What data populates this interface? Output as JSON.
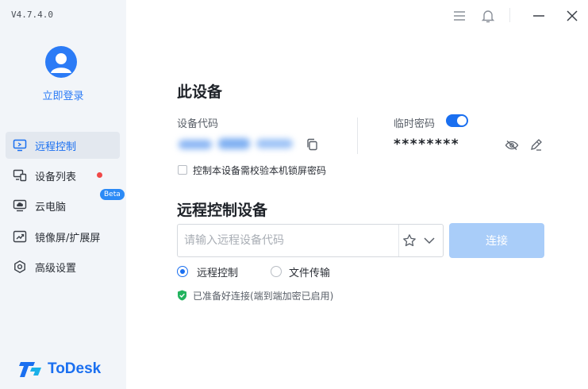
{
  "app": {
    "version": "V4.7.4.0",
    "brand": "ToDesk",
    "accent_color": "#1a6ff0"
  },
  "sidebar": {
    "login_label": "立即登录",
    "items": [
      {
        "label": "远程控制",
        "icon": "monitor-remote-icon",
        "active": true
      },
      {
        "label": "设备列表",
        "icon": "device-list-icon",
        "badge": "red-dot"
      },
      {
        "label": "云电脑",
        "icon": "cloud-pc-icon",
        "tag": "Beta"
      },
      {
        "label": "镜像屏/扩展屏",
        "icon": "mirror-screen-icon"
      },
      {
        "label": "高级设置",
        "icon": "gear-icon"
      }
    ]
  },
  "titlebar": {
    "icons": [
      "menu-icon",
      "bell-icon",
      "minimize-icon",
      "close-icon"
    ]
  },
  "this_device": {
    "title": "此设备",
    "code_label": "设备代码",
    "temp_password_label": "临时密码",
    "temp_password_enabled": true,
    "temp_password": "********",
    "lock_screen_checkbox": {
      "label": "控制本设备需校验本机锁屏密码",
      "checked": false
    }
  },
  "remote": {
    "title": "远程控制设备",
    "input_placeholder": "请输入远程设备代码",
    "input_value": "",
    "connect_label": "连接",
    "modes": [
      {
        "label": "远程控制",
        "selected": true
      },
      {
        "label": "文件传输",
        "selected": false
      }
    ],
    "status": "已准备好连接(端到端加密已启用)"
  }
}
